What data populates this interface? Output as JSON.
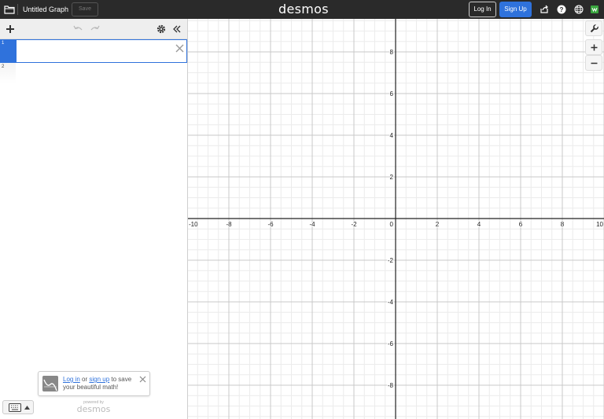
{
  "header": {
    "graph_title": "Untitled Graph",
    "save_label": "Save",
    "logo": "desmos",
    "login_label": "Log In",
    "signup_label": "Sign Up",
    "icons": [
      "folder-icon",
      "share-icon",
      "help-icon",
      "globe-icon",
      "keyboard-shortcut-icon"
    ]
  },
  "expressions": {
    "items": [
      {
        "index": "1",
        "value": ""
      },
      {
        "index": "2",
        "value": ""
      }
    ]
  },
  "prompt": {
    "login_link": "Log in",
    "or_text": " or ",
    "signup_link": "sign up",
    "rest_text": " to save your beautiful math!"
  },
  "powered": {
    "small": "powered by",
    "name": "desmos"
  },
  "graph": {
    "x_range": [
      -10,
      10
    ],
    "y_range": [
      -9.5,
      9.5
    ],
    "x_ticks": [
      "-10",
      "-8",
      "-6",
      "-4",
      "-2",
      "0",
      "2",
      "4",
      "6",
      "8",
      "10"
    ],
    "y_ticks": [
      "8",
      "6",
      "4",
      "2",
      "-2",
      "-4",
      "-6",
      "-8"
    ],
    "axis_color": "#222222",
    "major_grid_color": "#c8c8c8",
    "minor_grid_color": "#ececec"
  },
  "colors": {
    "accent": "#2f72dc",
    "header_bg": "#2a2a2a"
  }
}
